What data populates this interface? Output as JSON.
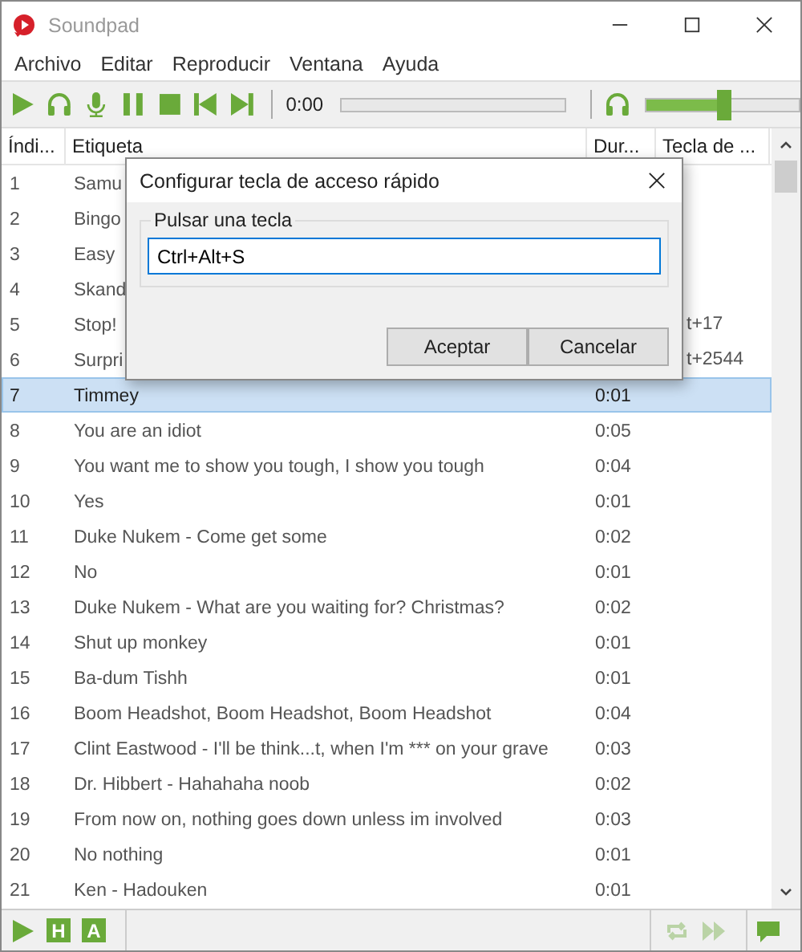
{
  "window": {
    "title": "Soundpad"
  },
  "menu": [
    "Archivo",
    "Editar",
    "Reproducir",
    "Ventana",
    "Ayuda"
  ],
  "toolbar": [
    {
      "kind": "play"
    },
    {
      "kind": "headphones"
    },
    {
      "kind": "mic"
    },
    {
      "kind": "pause"
    },
    {
      "kind": "stop"
    },
    {
      "kind": "prev"
    },
    {
      "kind": "next"
    }
  ],
  "time": "0:00",
  "progress": {
    "level": 0
  },
  "volume": {
    "level": 0.52
  },
  "columns": [
    "Índi...",
    "Etiqueta",
    "Dur...",
    "Tecla de ..."
  ],
  "rows": [
    {
      "index": "1",
      "label": "Samu",
      "selected": false
    },
    {
      "index": "2",
      "label": "Bingo",
      "selected": false
    },
    {
      "index": "3",
      "label": "Easy",
      "selected": false
    },
    {
      "index": "4",
      "label": "Skand",
      "selected": false
    },
    {
      "index": "5",
      "label": "Stop!",
      "hotkey": "t+17",
      "selected": false
    },
    {
      "index": "6",
      "label": "Surpri",
      "hotkey": "t+2544",
      "selected": false
    },
    {
      "index": "7",
      "label": "Timmey",
      "duration": "0:01",
      "selected": true
    },
    {
      "index": "8",
      "label": "You are an idiot",
      "duration": "0:05",
      "selected": false
    },
    {
      "index": "9",
      "label": "You want me to show you tough, I show you tough",
      "duration": "0:04",
      "selected": false
    },
    {
      "index": "10",
      "label": "Yes",
      "duration": "0:01",
      "selected": false
    },
    {
      "index": "11",
      "label": "Duke Nukem - Come get some",
      "duration": "0:02",
      "selected": false
    },
    {
      "index": "12",
      "label": "No",
      "duration": "0:01",
      "selected": false
    },
    {
      "index": "13",
      "label": "Duke Nukem - What are you waiting for? Christmas?",
      "duration": "0:02",
      "selected": false
    },
    {
      "index": "14",
      "label": "Shut up monkey",
      "duration": "0:01",
      "selected": false
    },
    {
      "index": "15",
      "label": "Ba-dum Tishh",
      "duration": "0:01",
      "selected": false
    },
    {
      "index": "16",
      "label": "Boom Headshot, Boom Headshot, Boom Headshot",
      "duration": "0:04",
      "selected": false
    },
    {
      "index": "17",
      "label": "Clint Eastwood - I'll be think...t, when I'm *** on your grave",
      "duration": "0:03",
      "selected": false
    },
    {
      "index": "18",
      "label": "Dr. Hibbert - Hahahaha noob",
      "duration": "0:02",
      "selected": false
    },
    {
      "index": "19",
      "label": "From now on, nothing goes down unless im involved",
      "duration": "0:03",
      "selected": false
    },
    {
      "index": "20",
      "label": "No nothing",
      "duration": "0:01",
      "selected": false
    },
    {
      "index": "21",
      "label": "Ken - Hadouken",
      "duration": "0:01",
      "selected": false
    }
  ],
  "bottom_left": [
    {
      "kind": "play"
    },
    {
      "kind": "letter",
      "text": "H"
    },
    {
      "kind": "letter",
      "text": "A"
    }
  ],
  "bottom_right": [
    {
      "kind": "repeat",
      "disabled": true
    },
    {
      "kind": "forward",
      "disabled": true
    }
  ],
  "bottom_end": {
    "kind": "chat"
  },
  "dialog": {
    "title": "Configurar tecla de acceso rápido",
    "group_label": "Pulsar una tecla",
    "value": "Ctrl+Alt+S",
    "buttons": [
      "Aceptar",
      "Cancelar"
    ]
  }
}
